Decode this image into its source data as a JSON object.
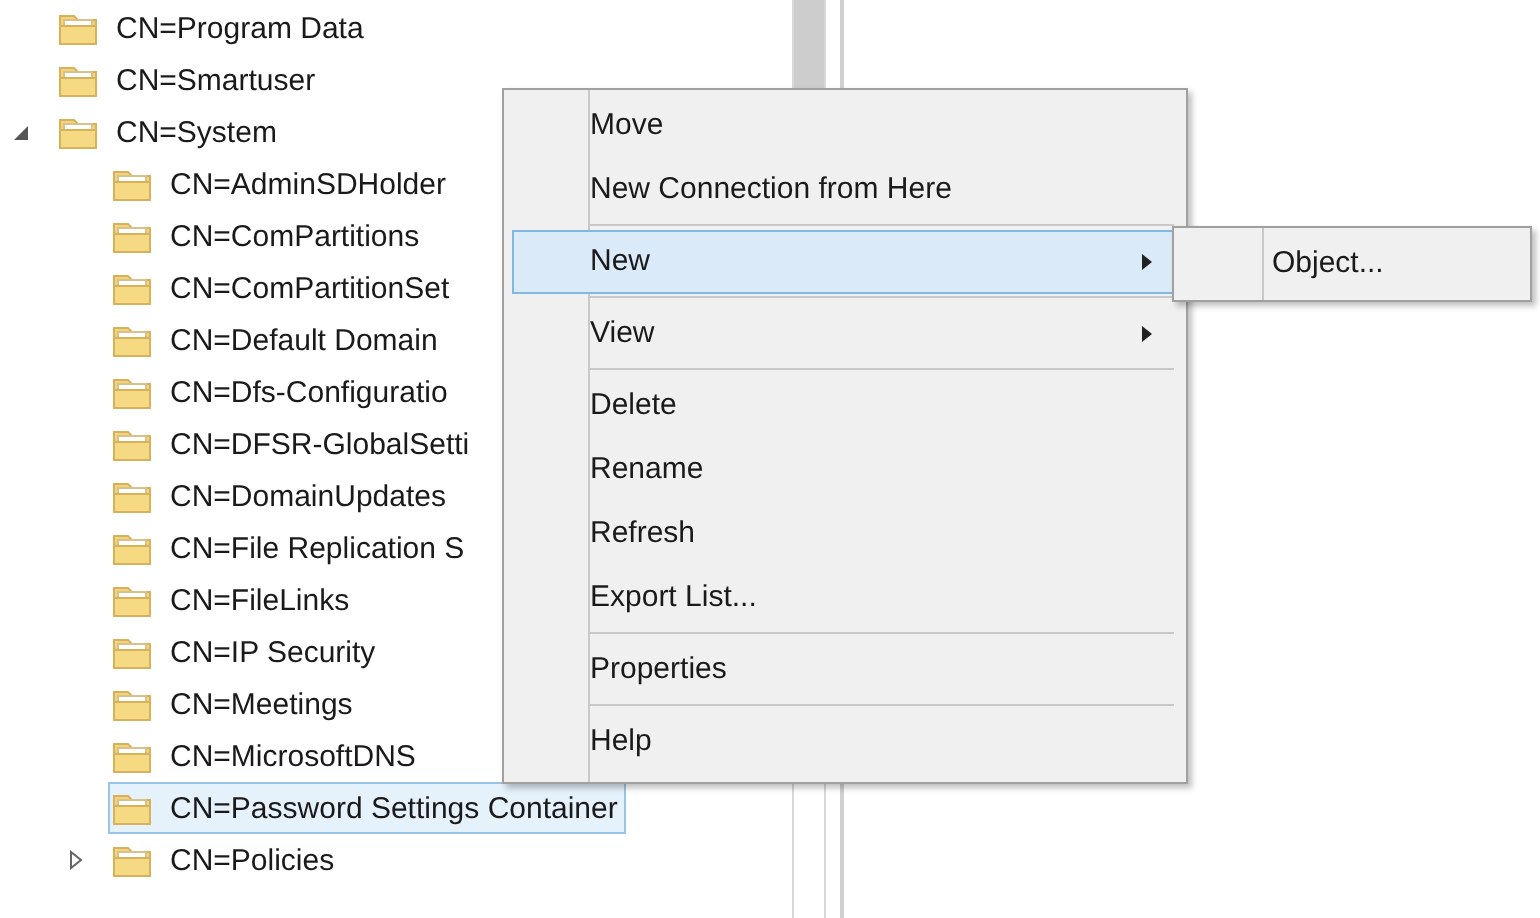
{
  "tree": [
    {
      "label": "CN=Program Data",
      "selected": false
    },
    {
      "label": "CN=Smartuser",
      "selected": false
    },
    {
      "label": "CN=System",
      "selected": false,
      "expanded": true,
      "children": [
        {
          "label": "CN=AdminSDHolder",
          "selected": false
        },
        {
          "label": "CN=ComPartitions",
          "selected": false
        },
        {
          "label": "CN=ComPartitionSet",
          "selected": false
        },
        {
          "label": "CN=Default Domain",
          "selected": false
        },
        {
          "label": "CN=Dfs-Configuratio",
          "selected": false
        },
        {
          "label": "CN=DFSR-GlobalSetti",
          "selected": false
        },
        {
          "label": "CN=DomainUpdates",
          "selected": false
        },
        {
          "label": "CN=File Replication S",
          "selected": false
        },
        {
          "label": "CN=FileLinks",
          "selected": false
        },
        {
          "label": "CN=IP Security",
          "selected": false
        },
        {
          "label": "CN=Meetings",
          "selected": false
        },
        {
          "label": "CN=MicrosoftDNS",
          "selected": false
        },
        {
          "label": "CN=Password Settings Container",
          "selected": true
        },
        {
          "label": "CN=Policies",
          "selected": false,
          "expanded": false
        }
      ]
    }
  ],
  "context_menu": {
    "items": [
      {
        "kind": "item",
        "label": "Move",
        "selected": false,
        "has_submenu": false
      },
      {
        "kind": "item",
        "label": "New Connection from Here",
        "selected": false,
        "has_submenu": false
      },
      {
        "kind": "separator"
      },
      {
        "kind": "item",
        "label": "New",
        "selected": true,
        "has_submenu": true
      },
      {
        "kind": "separator"
      },
      {
        "kind": "item",
        "label": "View",
        "selected": false,
        "has_submenu": true
      },
      {
        "kind": "separator"
      },
      {
        "kind": "item",
        "label": "Delete",
        "selected": false,
        "has_submenu": false
      },
      {
        "kind": "item",
        "label": "Rename",
        "selected": false,
        "has_submenu": false
      },
      {
        "kind": "item",
        "label": "Refresh",
        "selected": false,
        "has_submenu": false
      },
      {
        "kind": "item",
        "label": "Export List...",
        "selected": false,
        "has_submenu": false
      },
      {
        "kind": "separator"
      },
      {
        "kind": "item",
        "label": "Properties",
        "selected": false,
        "has_submenu": false
      },
      {
        "kind": "separator"
      },
      {
        "kind": "item",
        "label": "Help",
        "selected": false,
        "has_submenu": false
      }
    ]
  },
  "submenu": {
    "items": [
      {
        "kind": "item",
        "label": "Object...",
        "selected": false
      }
    ]
  }
}
